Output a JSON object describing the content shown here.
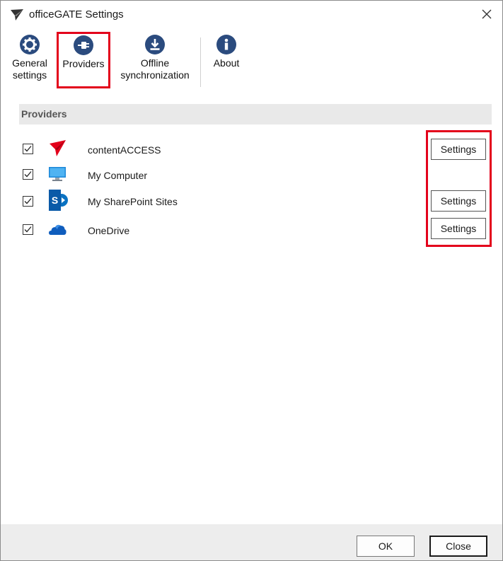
{
  "window": {
    "title": "officeGATE Settings"
  },
  "ribbon": {
    "general": {
      "line1": "General",
      "line2": "settings",
      "icon": "gear-icon"
    },
    "providers": {
      "label": "Providers",
      "icon": "plug-icon"
    },
    "offline": {
      "line1": "Offline",
      "line2": "synchronization",
      "icon": "cloud-download-icon"
    },
    "about": {
      "label": "About",
      "icon": "info-icon"
    }
  },
  "providers": {
    "header": "Providers",
    "items": [
      {
        "name": "contentACCESS",
        "checked": true,
        "settings_label": "Settings",
        "icon": "contentaccess-logo-icon"
      },
      {
        "name": "My Computer",
        "checked": true,
        "settings_label": "",
        "icon": "monitor-icon"
      },
      {
        "name": "My SharePoint Sites",
        "checked": true,
        "settings_label": "Settings",
        "icon": "sharepoint-icon"
      },
      {
        "name": "OneDrive",
        "checked": true,
        "settings_label": "Settings",
        "icon": "onedrive-icon"
      }
    ]
  },
  "footer": {
    "ok_label": "OK",
    "close_label": "Close"
  },
  "colors": {
    "accent_icon": "#2b4b7e",
    "highlight": "#e3001b",
    "logo_red": "#e3001b",
    "sharepoint_blue": "#0a72c2",
    "onedrive_blue": "#0f5dbd"
  }
}
